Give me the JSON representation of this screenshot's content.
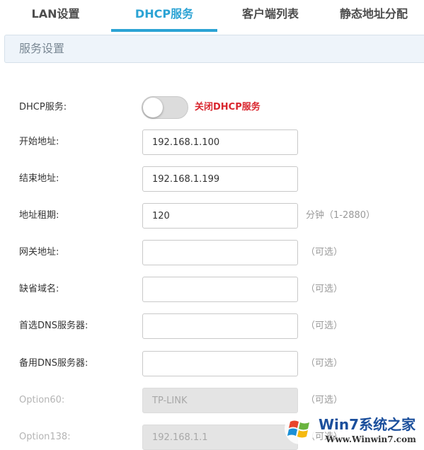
{
  "tabs": [
    {
      "label": "LAN设置",
      "active": false
    },
    {
      "label": "DHCP服务",
      "active": true
    },
    {
      "label": "客户端列表",
      "active": false
    },
    {
      "label": "静态地址分配",
      "active": false
    }
  ],
  "accent_color": "#2ba3d4",
  "section": {
    "title": "服务设置"
  },
  "dhcp_service": {
    "label": "DHCP服务:",
    "enabled": false,
    "status_text": "关闭DHCP服务",
    "status_color": "#d9262e"
  },
  "fields": {
    "start_address": {
      "label": "开始地址:",
      "value": "192.168.1.100"
    },
    "end_address": {
      "label": "结束地址:",
      "value": "192.168.1.199"
    },
    "lease_time": {
      "label": "地址租期:",
      "value": "120",
      "hint": "分钟（1-2880）"
    },
    "gateway": {
      "label": "网关地址:",
      "value": "",
      "hint": "（可选）"
    },
    "default_domain": {
      "label": "缺省域名:",
      "value": "",
      "hint": "（可选）"
    },
    "primary_dns": {
      "label": "首选DNS服务器:",
      "value": "",
      "hint": "（可选）"
    },
    "secondary_dns": {
      "label": "备用DNS服务器:",
      "value": "",
      "hint": "（可选）"
    },
    "option60": {
      "label": "Option60:",
      "value": "TP-LINK",
      "hint": "（可选）",
      "disabled": true
    },
    "option138": {
      "label": "Option138:",
      "value": "192.168.1.1",
      "hint": "（可选）",
      "disabled": true
    }
  },
  "watermark": {
    "logo": "windows-flag-logo",
    "title": "Win7系统之家",
    "url": "Www.Winwin7.com"
  }
}
